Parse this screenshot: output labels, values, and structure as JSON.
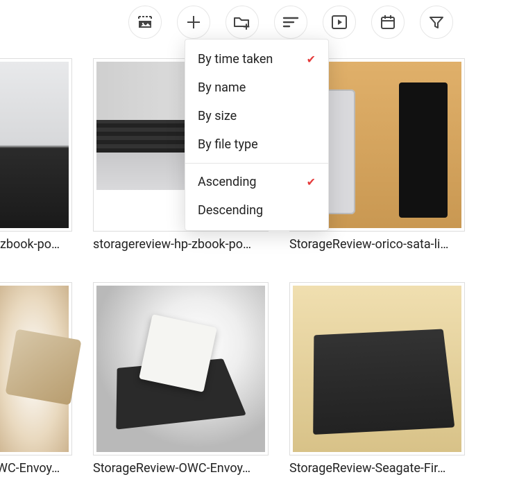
{
  "sort_menu": {
    "options": [
      {
        "label": "By time taken",
        "selected": true
      },
      {
        "label": "By name",
        "selected": false
      },
      {
        "label": "By size",
        "selected": false
      },
      {
        "label": "By file type",
        "selected": false
      }
    ],
    "directions": [
      {
        "label": "Ascending",
        "selected": true
      },
      {
        "label": "Descending",
        "selected": false
      }
    ]
  },
  "items": [
    {
      "caption": "-zbook-po…"
    },
    {
      "caption": "storagereview-hp-zbook-po…"
    },
    {
      "caption": "StorageReview-orico-sata-li…"
    },
    {
      "caption": "WC-Envoy…"
    },
    {
      "caption": "StorageReview-OWC-Envoy…"
    },
    {
      "caption": "StorageReview-Seagate-Fir…"
    }
  ]
}
